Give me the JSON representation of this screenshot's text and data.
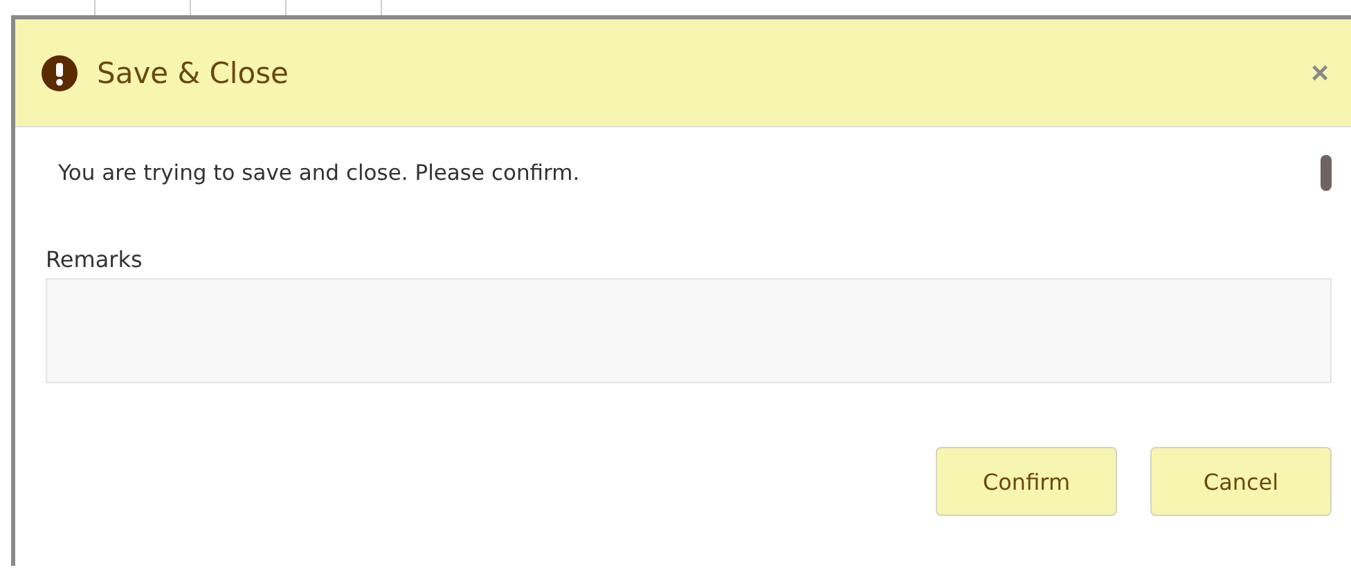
{
  "dialog": {
    "title": "Save & Close",
    "close": "×",
    "message": "You are trying to save and close. Please confirm.",
    "remarks": {
      "label": "Remarks"
    },
    "buttons": [
      "Confirm",
      "Cancel"
    ]
  }
}
